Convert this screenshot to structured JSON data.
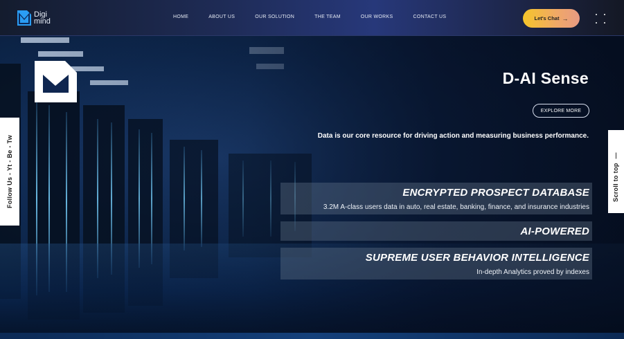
{
  "brand": {
    "name_line1": "Digi",
    "name_line2": "mind",
    "accent": "#2a9df4"
  },
  "nav": {
    "items": [
      {
        "label": "HOME"
      },
      {
        "label": "ABOUT US"
      },
      {
        "label": "OUR SOLUTION"
      },
      {
        "label": "THE TEAM"
      },
      {
        "label": "OUR WORKS"
      },
      {
        "label": "CONTACT US"
      }
    ],
    "cta_label": "Let's Chat",
    "cta_arrow": "→",
    "menu_icon": "dots-grid-icon"
  },
  "hero": {
    "title": "D-AI Sense",
    "explore_label": "EXPLORE MORE",
    "tagline": "Data is our core resource for driving action and measuring business performance.",
    "features": [
      {
        "title": "ENCRYPTED PROSPECT DATABASE",
        "desc": "3.2M A-class users data in auto, real estate, banking, finance, and insurance industries"
      },
      {
        "title": "AI-POWERED",
        "desc": ""
      },
      {
        "title": "SUPREME USER BEHAVIOR INTELLIGENCE",
        "desc": "In-depth Analytics proved by indexes"
      }
    ]
  },
  "side": {
    "follow_text": "Follow Us -  Yt  -  Be  -  Tw",
    "scroll_text": "Scroll to top",
    "scroll_dash": "—"
  },
  "colors": {
    "cta_gradient_start": "#f5c52a",
    "cta_gradient_end": "#e79a83",
    "nav_bg": "#1e2b55"
  }
}
